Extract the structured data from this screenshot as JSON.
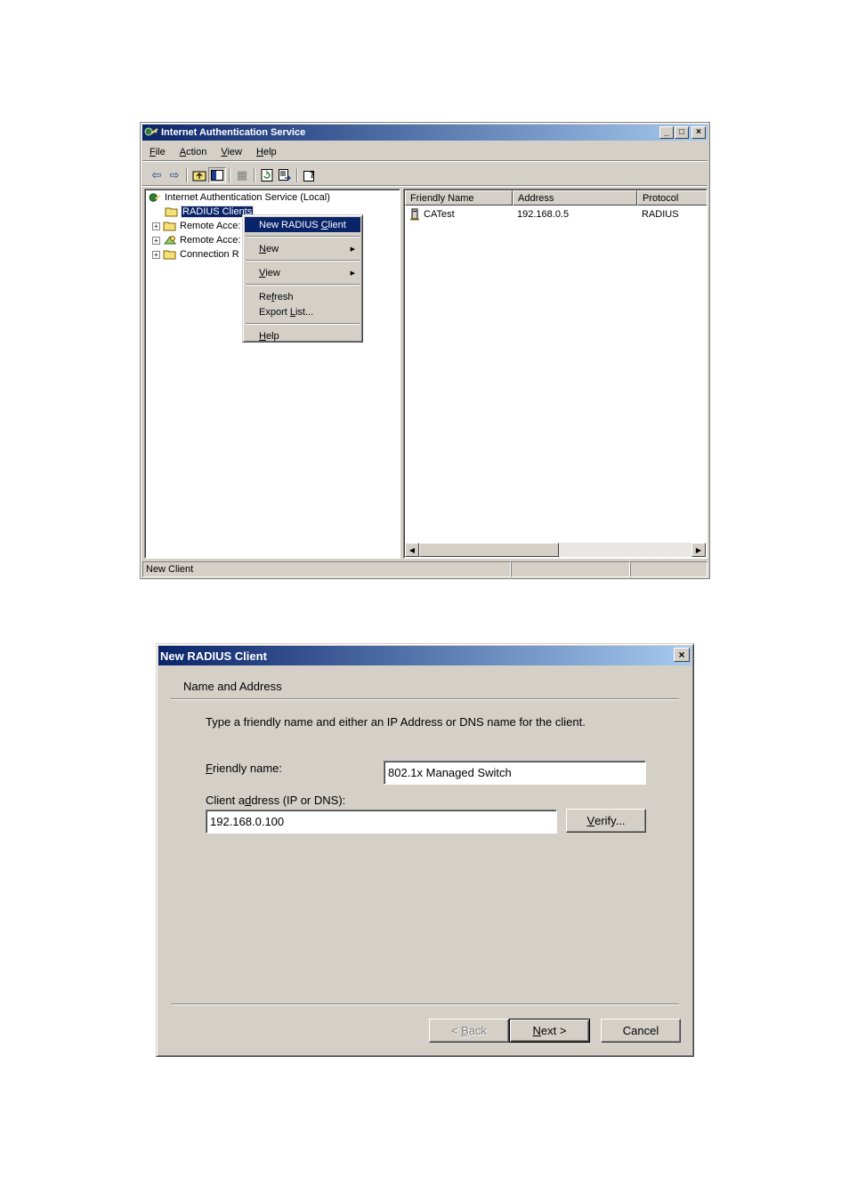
{
  "mmc": {
    "title": "Internet Authentication Service",
    "window_controls": {
      "minimize": "_",
      "maximize": "□",
      "close": "×"
    },
    "menu": [
      {
        "label": "File",
        "accel": "F",
        "rest": "ile"
      },
      {
        "label": "Action",
        "accel": "A",
        "rest": "ction"
      },
      {
        "label": "View",
        "accel": "V",
        "rest": "iew"
      },
      {
        "label": "Help",
        "accel": "H",
        "rest": "elp"
      }
    ],
    "toolbar_icons": [
      "back-arrow-icon",
      "forward-arrow-icon",
      "up-folder-icon",
      "show-hide-tree-icon",
      "delete-icon",
      "refresh-icon",
      "export-list-icon",
      "help-icon"
    ],
    "tree": {
      "root": "Internet Authentication Service (Local)",
      "items": [
        {
          "label": "RADIUS Clients",
          "selected": true,
          "expandable": false
        },
        {
          "label": "Remote Acce:",
          "expandable": true
        },
        {
          "label": "Remote Acce:",
          "expandable": true
        },
        {
          "label": "Connection R",
          "expandable": true
        }
      ]
    },
    "list": {
      "columns": [
        "Friendly Name",
        "Address",
        "Protocol"
      ],
      "rows": [
        {
          "name": "CATest",
          "address": "192.168.0.5",
          "protocol": "RADIUS"
        }
      ]
    },
    "context_menu": {
      "new_radius_client": {
        "pre": "New RADIUS ",
        "accel": "C",
        "post": "lient"
      },
      "new": {
        "accel": "N",
        "rest": "ew"
      },
      "view": {
        "accel": "V",
        "rest": "iew"
      },
      "refresh": {
        "pre": "Re",
        "accel": "f",
        "post": "resh"
      },
      "export_list": {
        "pre": "Export ",
        "accel": "L",
        "post": "ist..."
      },
      "help": {
        "accel": "H",
        "rest": "elp"
      }
    },
    "status": {
      "text": "New Client"
    },
    "colors": {
      "title_start": "#0a246a",
      "title_end": "#a6caf0",
      "face": "#d4d0c8",
      "highlight": "#0a246a"
    }
  },
  "dialog": {
    "title": "New RADIUS Client",
    "close": "×",
    "section_header": "Name and Address",
    "instruction": "Type a friendly name and either an IP Address or DNS name for the client.",
    "friendly_name_label": {
      "accel": "F",
      "rest": "riendly name:"
    },
    "friendly_name_value": "802.1x Managed Switch",
    "client_address_label": {
      "pre": "Client a",
      "accel": "d",
      "post": "dress (IP or DNS):"
    },
    "client_address_value": "192.168.0.100",
    "verify_button": {
      "accel": "V",
      "rest": "erify..."
    },
    "back_button": {
      "pre": "< ",
      "accel": "B",
      "post": "ack"
    },
    "next_button": {
      "accel": "N",
      "rest": "ext >"
    },
    "cancel_button": "Cancel"
  }
}
